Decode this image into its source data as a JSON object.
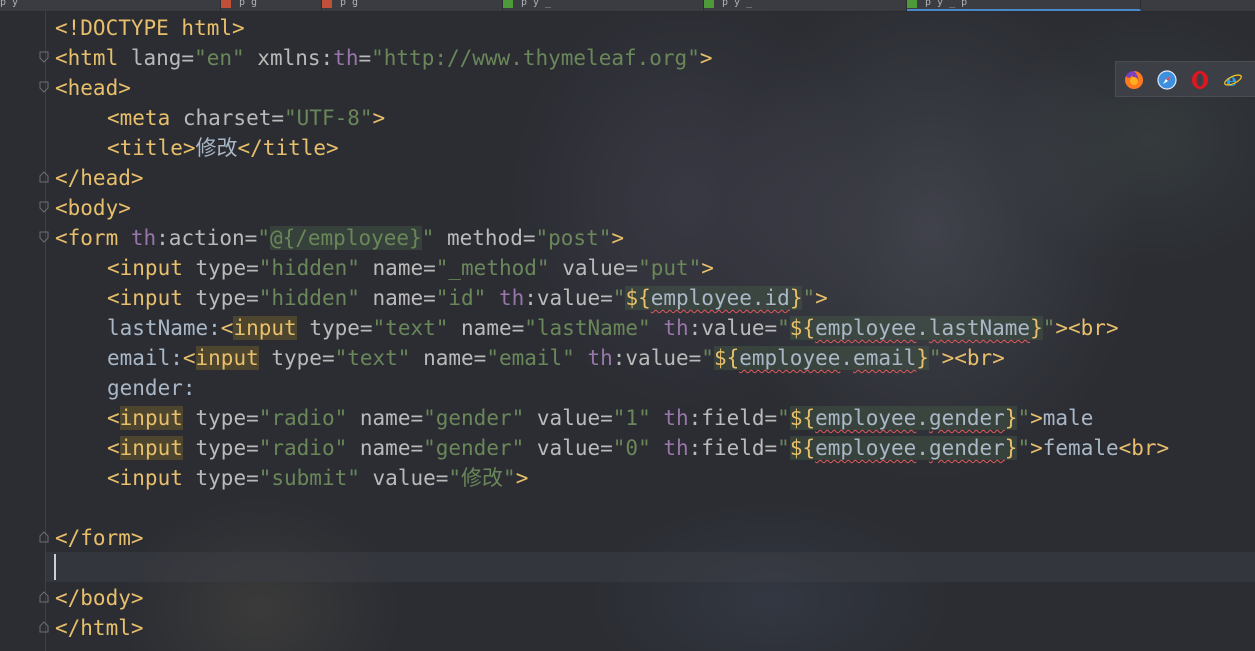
{
  "tabs": [
    {
      "name": "tab-1",
      "label": "p y"
    },
    {
      "name": "tab-2",
      "label": "p g"
    },
    {
      "name": "tab-3",
      "label": "p y _"
    },
    {
      "name": "tab-4",
      "label": "p y _"
    },
    {
      "name": "tab-5",
      "label": "p y _ p"
    }
  ],
  "code": {
    "l1": {
      "a": "<!DOCTYPE html>"
    },
    "l2": {
      "t1": "<html ",
      "a1": "lang=",
      "s1": "\"en\"",
      "a2": " xmlns:",
      "n1": "th",
      "a3": "=",
      "s2": "\"http://www.thymeleaf.org\"",
      "t2": ">"
    },
    "l3": {
      "t1": "<head>"
    },
    "l4": {
      "t1": "<meta ",
      "a1": "charset=",
      "s1": "\"UTF-8\"",
      "t2": ">"
    },
    "l5": {
      "t1": "<title>",
      "p1": "修改",
      "t2": "</title>"
    },
    "l6": {
      "t1": "</head>"
    },
    "l7": {
      "t1": "<body>"
    },
    "l8": {
      "t1": "<form ",
      "n1": "th",
      "a1": ":action=",
      "s1": "\"",
      "e1": "@{/employee}",
      "s2": "\"",
      "a2": " method=",
      "s3": "\"post\"",
      "t2": ">"
    },
    "l9": {
      "t1": "<input ",
      "a1": "type=",
      "s1": "\"hidden\"",
      "a2": " name=",
      "s2": "\"_method\"",
      "a3": " value=",
      "s3": "\"put\"",
      "t2": ">"
    },
    "l10": {
      "t1": "<input ",
      "a1": "type=",
      "s1": "\"hidden\"",
      "a2": " name=",
      "s2": "\"id\"",
      "n1": " th",
      "a3": ":value=",
      "s3": "\"",
      "e1a": "${",
      "e1b": "employee.id",
      "e1c": "}",
      "s4": "\"",
      "t2": ">"
    },
    "l11": {
      "p1": "lastName:",
      "t1a": "<",
      "t1b": "input",
      "a1": " type=",
      "s1": "\"text\"",
      "a2": " name=",
      "s2": "\"lastName\"",
      "n1": " th",
      "a3": ":value=",
      "s3": "\"",
      "e1a": "${",
      "e1b": "employee",
      "e1c": ".",
      "e1d": "lastName",
      "e1e": "}",
      "s4": "\"",
      "t2": "><br>"
    },
    "l12": {
      "p1": "email:",
      "t1a": "<",
      "t1b": "input",
      "a1": " type=",
      "s1": "\"text\"",
      "a2": " name=",
      "s2": "\"email\"",
      "n1": " th",
      "a3": ":value=",
      "s3": "\"",
      "e1a": "${",
      "e1b": "employee",
      "e1c": ".",
      "e1d": "email",
      "e1e": "}",
      "s4": "\"",
      "t2": "><br>"
    },
    "l13": {
      "p1": "gender:"
    },
    "l14": {
      "t1a": "<",
      "t1b": "input",
      "a1": " type=",
      "s1": "\"radio\"",
      "a2": " name=",
      "s2": "\"gender\"",
      "a3": " value=",
      "s3": "\"1\"",
      "n1": " th",
      "a4": ":field=",
      "s4": "\"",
      "e1a": "${",
      "e1b": "employee",
      "e1c": ".",
      "e1d": "gender",
      "e1e": "}",
      "s5": "\"",
      "t2": ">",
      "p1": "male"
    },
    "l15": {
      "t1a": "<",
      "t1b": "input",
      "a1": " type=",
      "s1": "\"radio\"",
      "a2": " name=",
      "s2": "\"gender\"",
      "a3": " value=",
      "s3": "\"0\"",
      "n1": " th",
      "a4": ":field=",
      "s4": "\"",
      "e1a": "${",
      "e1b": "employee",
      "e1c": ".",
      "e1d": "gender",
      "e1e": "}",
      "s5": "\"",
      "t2": ">",
      "p1": "female",
      "t3": "<br>"
    },
    "l16": {
      "t1": "<input ",
      "a1": "type=",
      "s1": "\"submit\"",
      "a2": " value=",
      "s2": "\"修改\"",
      "t2": ">"
    },
    "l18": {
      "t1": "</form>"
    },
    "l20": {
      "t1": "</body>"
    },
    "l21": {
      "t1": "</html>"
    }
  },
  "browsers": [
    "firefox-icon",
    "safari-icon",
    "opera-icon",
    "ie-icon"
  ],
  "colors": {
    "tag": "#e8bf6a",
    "attr": "#bababa",
    "string": "#6a8759",
    "namespace": "#9876aa",
    "text": "#a9b7c6",
    "background": "#2b2d33"
  }
}
